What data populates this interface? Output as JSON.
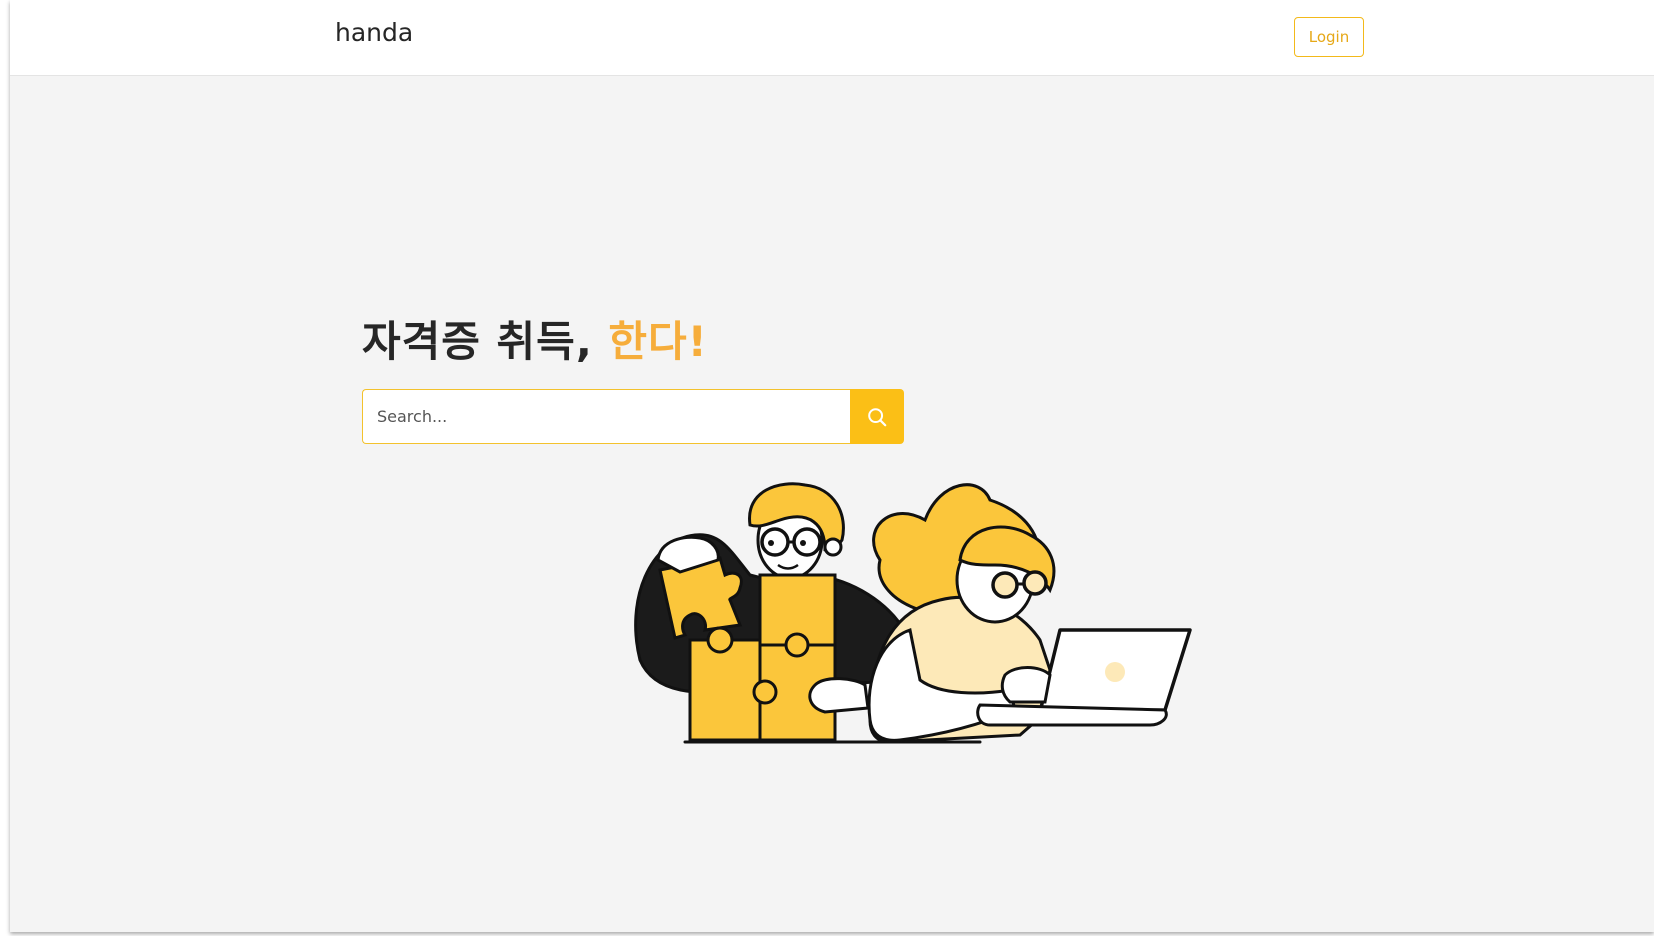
{
  "navbar": {
    "brand": "handa",
    "login_label": "Login"
  },
  "hero": {
    "title_main": "자격증 취득, ",
    "title_accent": "한다!"
  },
  "search": {
    "placeholder": "Search...",
    "button_icon": "search-icon"
  },
  "illustration": {
    "name": "people-solving-puzzle-illustration"
  },
  "colors": {
    "accent": "#fbbf16",
    "accent_text": "#f6ad3b",
    "background": "#f4f4f4",
    "navbar": "#ffffff",
    "text": "#262626"
  }
}
